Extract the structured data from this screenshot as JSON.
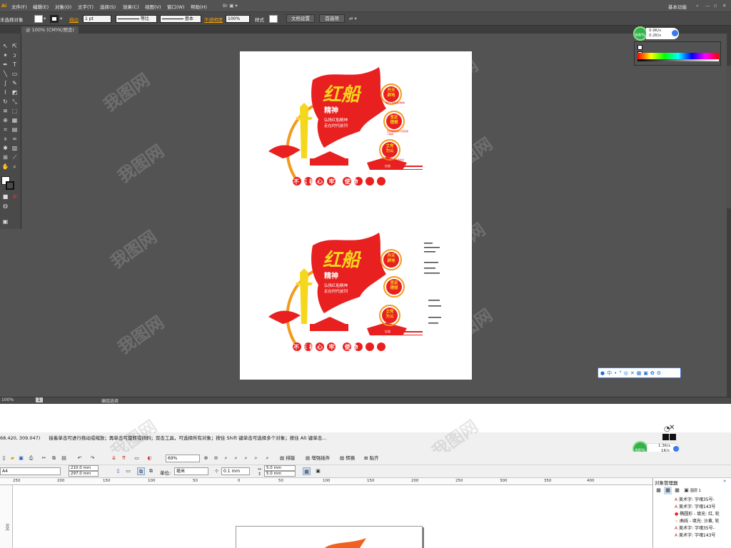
{
  "illustrator": {
    "app_icon": "Ai",
    "menu": [
      "文件(F)",
      "编辑(E)",
      "对象(O)",
      "文字(T)",
      "选择(S)",
      "效果(C)",
      "视图(V)",
      "窗口(W)",
      "帮助(H)"
    ],
    "workspace": "基本功能",
    "control": {
      "no_selection": "未选择对象",
      "stroke_label": "描边",
      "stroke_weight": "1 pt",
      "stroke_profile": "等比",
      "brush": "基本",
      "opacity_label": "不透明度",
      "opacity_value": "100%",
      "style_label": "样式",
      "doc_setup": "文档设置",
      "preferences": "首选项"
    },
    "tab_title": "@ 100% (CMYK/预览)",
    "status": {
      "zoom": "100%",
      "page": "1",
      "tool": "编组选择"
    },
    "net_meter": {
      "percent": "68%",
      "up": "0.9K/s",
      "down": "0.2K/s"
    },
    "accent_colors": {
      "red": "#e8201f",
      "gold": "#f5d81e",
      "orange": "#f39a1d"
    }
  },
  "artwork": {
    "title": "红船",
    "subtitle": "精神",
    "slogan_line1": "弘扬红船精神",
    "slogan_line2": "走在时代前列",
    "circles": [
      "开天辟地",
      "坚定理想",
      "立党为公"
    ],
    "circle_captions": [
      "敢为人先的首创精神",
      "坚定理想百折不挠的奋斗精神",
      "立党为公忠诚为民的奉献精神"
    ],
    "bottom_banner": "不忘初心 牢记使命",
    "boat_text": "红船"
  },
  "coreldraw": {
    "status_coords": "68.420, 309.047)",
    "status_hint": "接着单击可进行拖动或缩放；再单击可旋转或倾斜；双击工具，可选择所有对象；按住 Shift 键单击可选择多个对象；按住 Alt 键单击...",
    "zoom": "69%",
    "buttons": [
      "排版",
      "增强插件",
      "转换",
      "贴齐"
    ],
    "page_size": "A4",
    "width": "210.0 mm",
    "height": "297.0 mm",
    "unit_label": "单位:",
    "unit": "毫米",
    "nudge": "0.1 mm",
    "dup_x": "5.0 mm",
    "dup_y": "5.0 mm",
    "ruler_ticks": [
      "250",
      "200",
      "150",
      "100",
      "50",
      "0",
      "50",
      "100",
      "150",
      "200",
      "250",
      "300",
      "350",
      "400"
    ],
    "vruler_ticks": [
      "300"
    ],
    "net_meter": {
      "percent": "66%",
      "up": "1.3K/s",
      "down": "1K/s"
    },
    "object_manager": {
      "title": "对象管理器",
      "layer": "图层 1",
      "items": [
        "美术字: 字魂35号-",
        "美术字: 字魂143号",
        "椭圆形 - 填充: 红, 轮",
        "曲线 - 填充: 沙黄, 轮",
        "美术字: 字魂35号-",
        "美术字: 字魂143号"
      ]
    }
  },
  "watermark": "我图网"
}
